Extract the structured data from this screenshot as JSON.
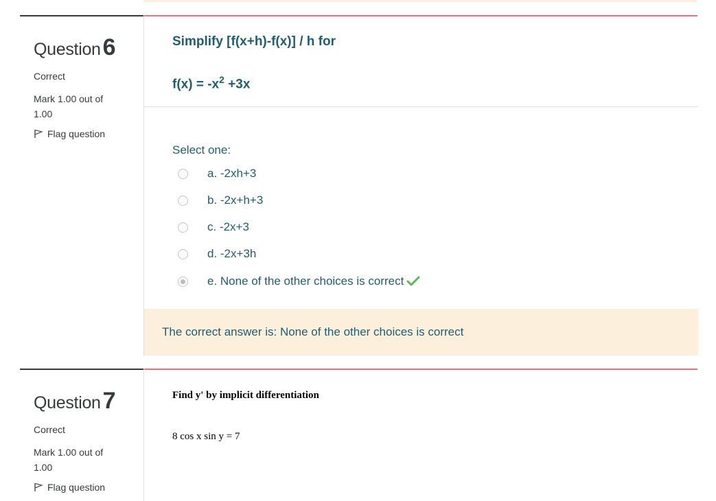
{
  "questions": [
    {
      "label": "Question",
      "number": "6",
      "state": "Correct",
      "grade": "Mark 1.00 out of 1.00",
      "flag_label": "Flag question",
      "text_line1": "Simplify [f(x+h)-f(x)] / h for",
      "text_line2_prefix": "f(x) = -x",
      "text_line2_sup": "2",
      "text_line2_suffix": " +3x",
      "prompt": "Select one:",
      "options": [
        {
          "label": "a. -2xh+3",
          "checked": false
        },
        {
          "label": "b. -2x+h+3",
          "checked": false
        },
        {
          "label": "c. -2x+3",
          "checked": false
        },
        {
          "label": "d. -2x+3h",
          "checked": false
        },
        {
          "label": "e. None of the other choices is correct",
          "checked": true
        }
      ],
      "feedback": "The correct answer is: None of the other choices is correct",
      "correct_icon": "check-icon",
      "correct_color": "#5cb85c"
    },
    {
      "label": "Question",
      "number": "7",
      "state": "Correct",
      "grade": "Mark 1.00 out of 1.00",
      "flag_label": "Flag question",
      "text_line1": "Find y' by implicit differentiation",
      "text_line2": "8 cos x sin y = 7"
    }
  ],
  "colors": {
    "accent_line": "#e8727c",
    "question_text": "#1f5d73",
    "feedback_bg": "#fcefdc"
  }
}
